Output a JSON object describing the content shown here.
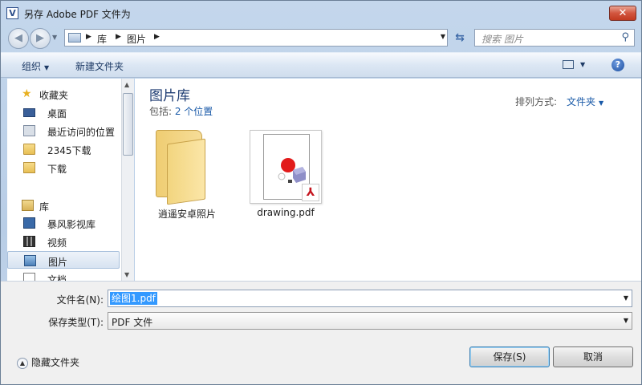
{
  "window": {
    "title": "另存 Adobe PDF 文件为",
    "app_icon": "V"
  },
  "nav": {
    "breadcrumbs": [
      "库",
      "图片"
    ],
    "search_placeholder": "搜索 图片"
  },
  "toolbar": {
    "organize_label": "组织",
    "new_folder_label": "新建文件夹"
  },
  "sidebar": {
    "favorites": {
      "label": "收藏夹",
      "items": [
        "桌面",
        "最近访问的位置",
        "2345下载",
        "下载"
      ]
    },
    "libraries": {
      "label": "库",
      "items": [
        "暴风影视库",
        "视频",
        "图片",
        "文档"
      ]
    },
    "selected": "图片"
  },
  "main": {
    "title": "图片库",
    "includes_prefix": "包括: ",
    "includes_link": "2 个位置",
    "sort_label": "排列方式:",
    "sort_value": "文件夹",
    "files": [
      {
        "name": "逍遥安卓照片",
        "type": "folder"
      },
      {
        "name": "drawing.pdf",
        "type": "pdf"
      }
    ]
  },
  "form": {
    "file_name_label": "文件名(N):",
    "file_name_value": "绘图1.pdf",
    "file_type_label": "保存类型(T):",
    "file_type_value": "PDF 文件",
    "hide_folders_label": "隐藏文件夹",
    "save_label": "保存(S)",
    "cancel_label": "取消"
  }
}
